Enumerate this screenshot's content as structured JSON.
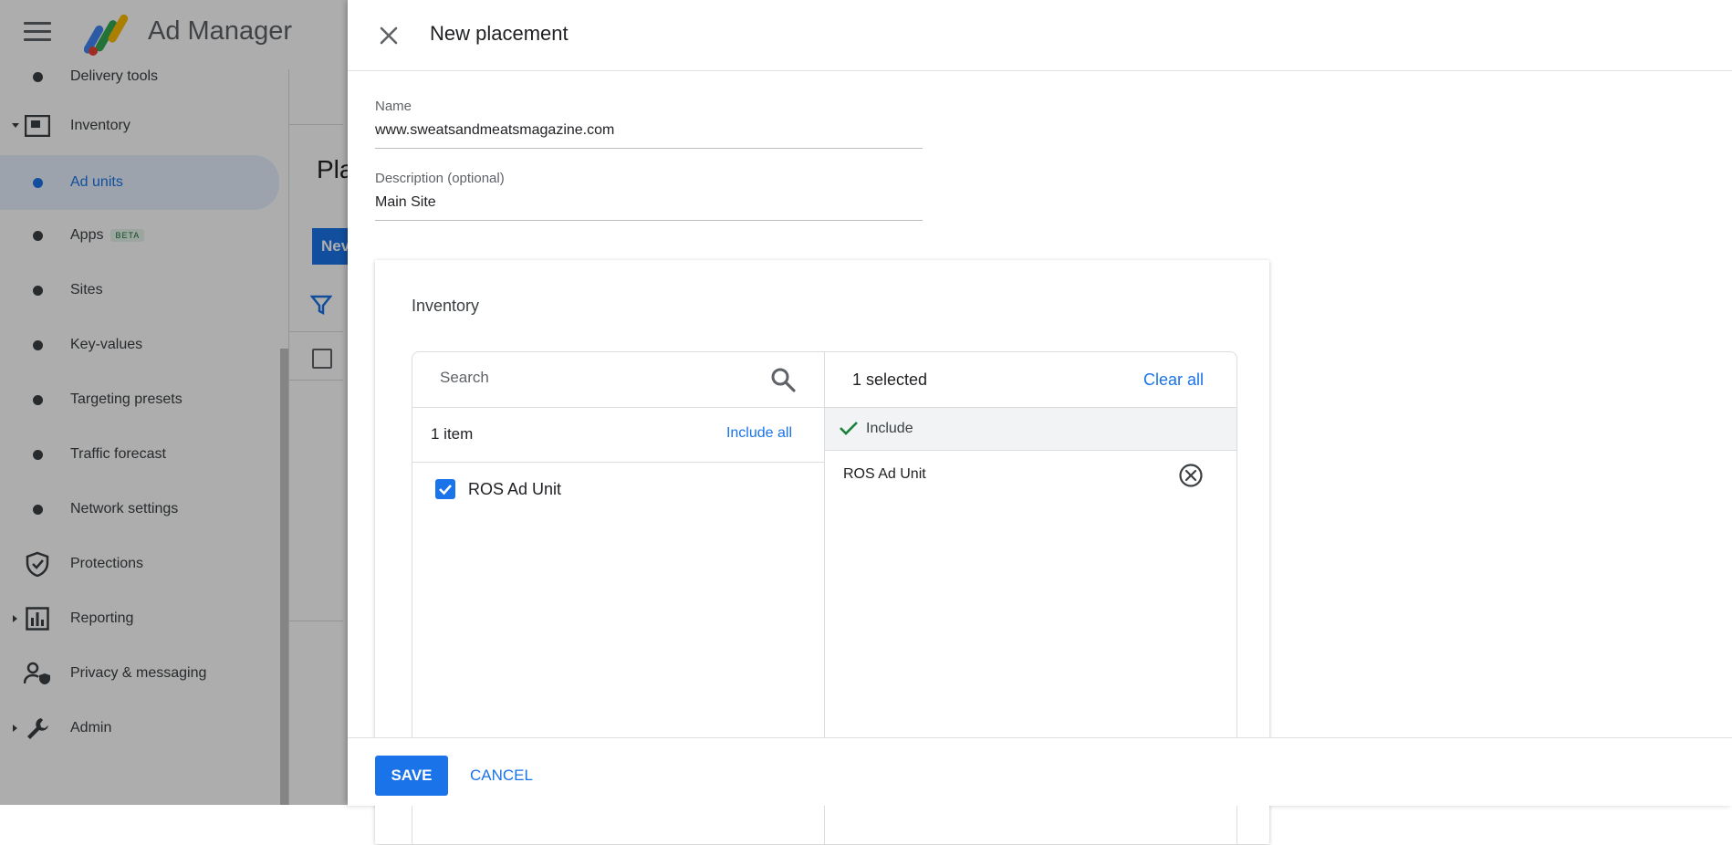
{
  "app": {
    "title": "Ad Manager"
  },
  "sidebar": {
    "items": [
      {
        "label": "Delivery tools",
        "type": "child"
      },
      {
        "label": "Inventory",
        "type": "section",
        "icon": "inventory-icon"
      },
      {
        "label": "Ad units",
        "type": "child",
        "active": true
      },
      {
        "label": "Apps",
        "type": "child",
        "badge": "BETA"
      },
      {
        "label": "Sites",
        "type": "child"
      },
      {
        "label": "Key-values",
        "type": "child"
      },
      {
        "label": "Targeting presets",
        "type": "child"
      },
      {
        "label": "Traffic forecast",
        "type": "child"
      },
      {
        "label": "Network settings",
        "type": "child"
      },
      {
        "label": "Protections",
        "type": "section",
        "icon": "shield-icon"
      },
      {
        "label": "Reporting",
        "type": "section",
        "icon": "bar-chart-icon"
      },
      {
        "label": "Privacy & messaging",
        "type": "section",
        "icon": "person-shield-icon"
      },
      {
        "label": "Admin",
        "type": "section",
        "icon": "wrench-icon"
      }
    ]
  },
  "background": {
    "page_title": "Pla",
    "new_button": "Nev"
  },
  "panel": {
    "title": "New placement",
    "name_label": "Name",
    "name_value": "www.sweatsandmeatsmagazine.com",
    "description_label": "Description (optional)",
    "description_value": "Main Site",
    "inventory": {
      "title": "Inventory",
      "search_placeholder": "Search",
      "item_count": "1 item",
      "include_all": "Include all",
      "items": [
        {
          "label": "ROS Ad Unit",
          "checked": true
        }
      ],
      "selected_count": "1 selected",
      "clear_all": "Clear all",
      "include_label": "Include",
      "selected_items": [
        {
          "label": "ROS Ad Unit"
        }
      ]
    },
    "footer": {
      "save": "SAVE",
      "cancel": "CANCEL"
    }
  },
  "colors": {
    "accent": "#1a73e8",
    "include_check": "#188038"
  }
}
